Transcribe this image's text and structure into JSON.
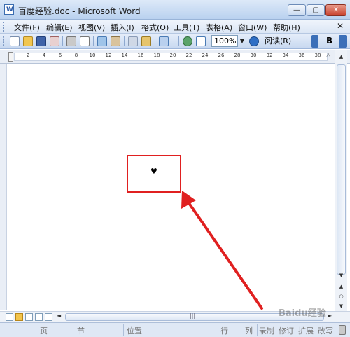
{
  "window": {
    "title": "百度经验.doc - Microsoft Word",
    "app_icon_letter": "W",
    "minimize_glyph": "—",
    "maximize_glyph": "▢",
    "close_glyph": "✕"
  },
  "menubar": {
    "items": [
      {
        "label": "文件(F)"
      },
      {
        "label": "编辑(E)"
      },
      {
        "label": "视图(V)"
      },
      {
        "label": "插入(I)"
      },
      {
        "label": "格式(O)"
      },
      {
        "label": "工具(T)"
      },
      {
        "label": "表格(A)"
      },
      {
        "label": "窗口(W)"
      },
      {
        "label": "帮助(H)"
      }
    ],
    "close_glyph": "✕"
  },
  "toolbar": {
    "zoom": "100%",
    "zoom_arrow": "▼",
    "read_label": "阅读(R)",
    "bold_label": "B"
  },
  "ruler": {
    "numbers": [
      "2",
      "4",
      "6",
      "8",
      "10",
      "12",
      "14",
      "16",
      "18",
      "20",
      "22",
      "24",
      "26",
      "28",
      "30",
      "32",
      "34",
      "36",
      "38"
    ],
    "right_mark": "△"
  },
  "document": {
    "symbol": "♥"
  },
  "vscroll": {
    "up": "▲",
    "down": "▼",
    "prev_page": "▲",
    "browse": "○",
    "next_page": "▼"
  },
  "hscroll": {
    "left": "◄",
    "right": "►",
    "grip": "|||"
  },
  "statusbar": {
    "page": "页",
    "section": "节",
    "position": "位置",
    "line": "行",
    "column": "列",
    "record": "录制",
    "revise": "修订",
    "extend": "扩展",
    "overwrite": "改写"
  },
  "watermark": "Baidu经验",
  "colors": {
    "annotation_red": "#e02020",
    "titlebar": "#c9daf0"
  }
}
